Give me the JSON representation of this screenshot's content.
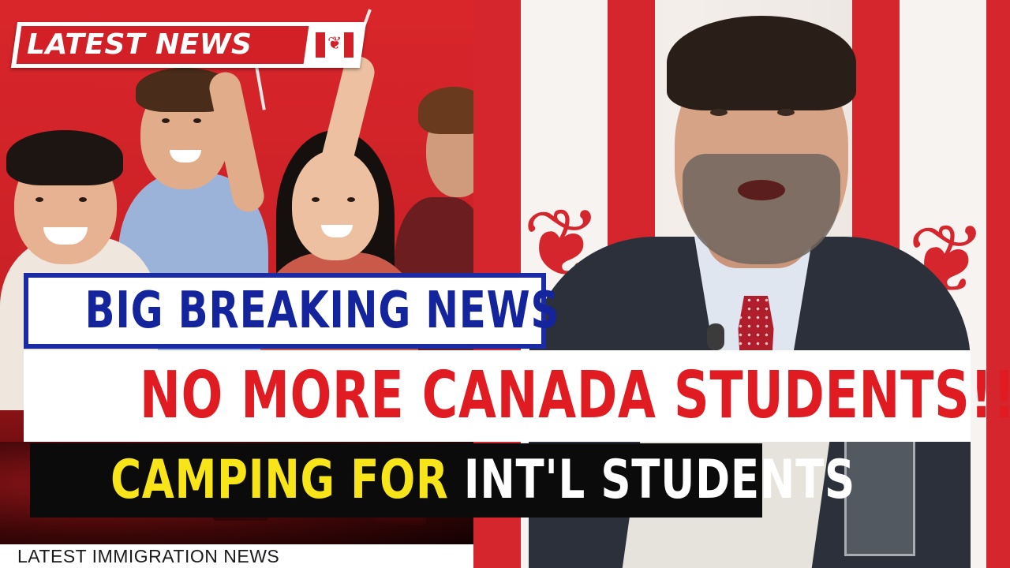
{
  "badge": {
    "label": "LATEST NEWS",
    "flag_icon": "canada-flag-icon"
  },
  "headline": {
    "line1": "BIG BREAKING NEWS",
    "line2": "NO MORE CANADA STUDENTS!!",
    "line3_part1": "CAMPING FOR",
    "line3_part2": "INT'L STUDENTS"
  },
  "footer": {
    "label": "LATEST IMMIGRATION NEWS"
  },
  "colors": {
    "badge_red": "#d31f26",
    "headline_blue": "#14249c",
    "headline_red": "#e01b22",
    "headline_yellow": "#f7e51a"
  },
  "icons": [
    "canada-flag-icon",
    "maple-leaf-icon"
  ]
}
